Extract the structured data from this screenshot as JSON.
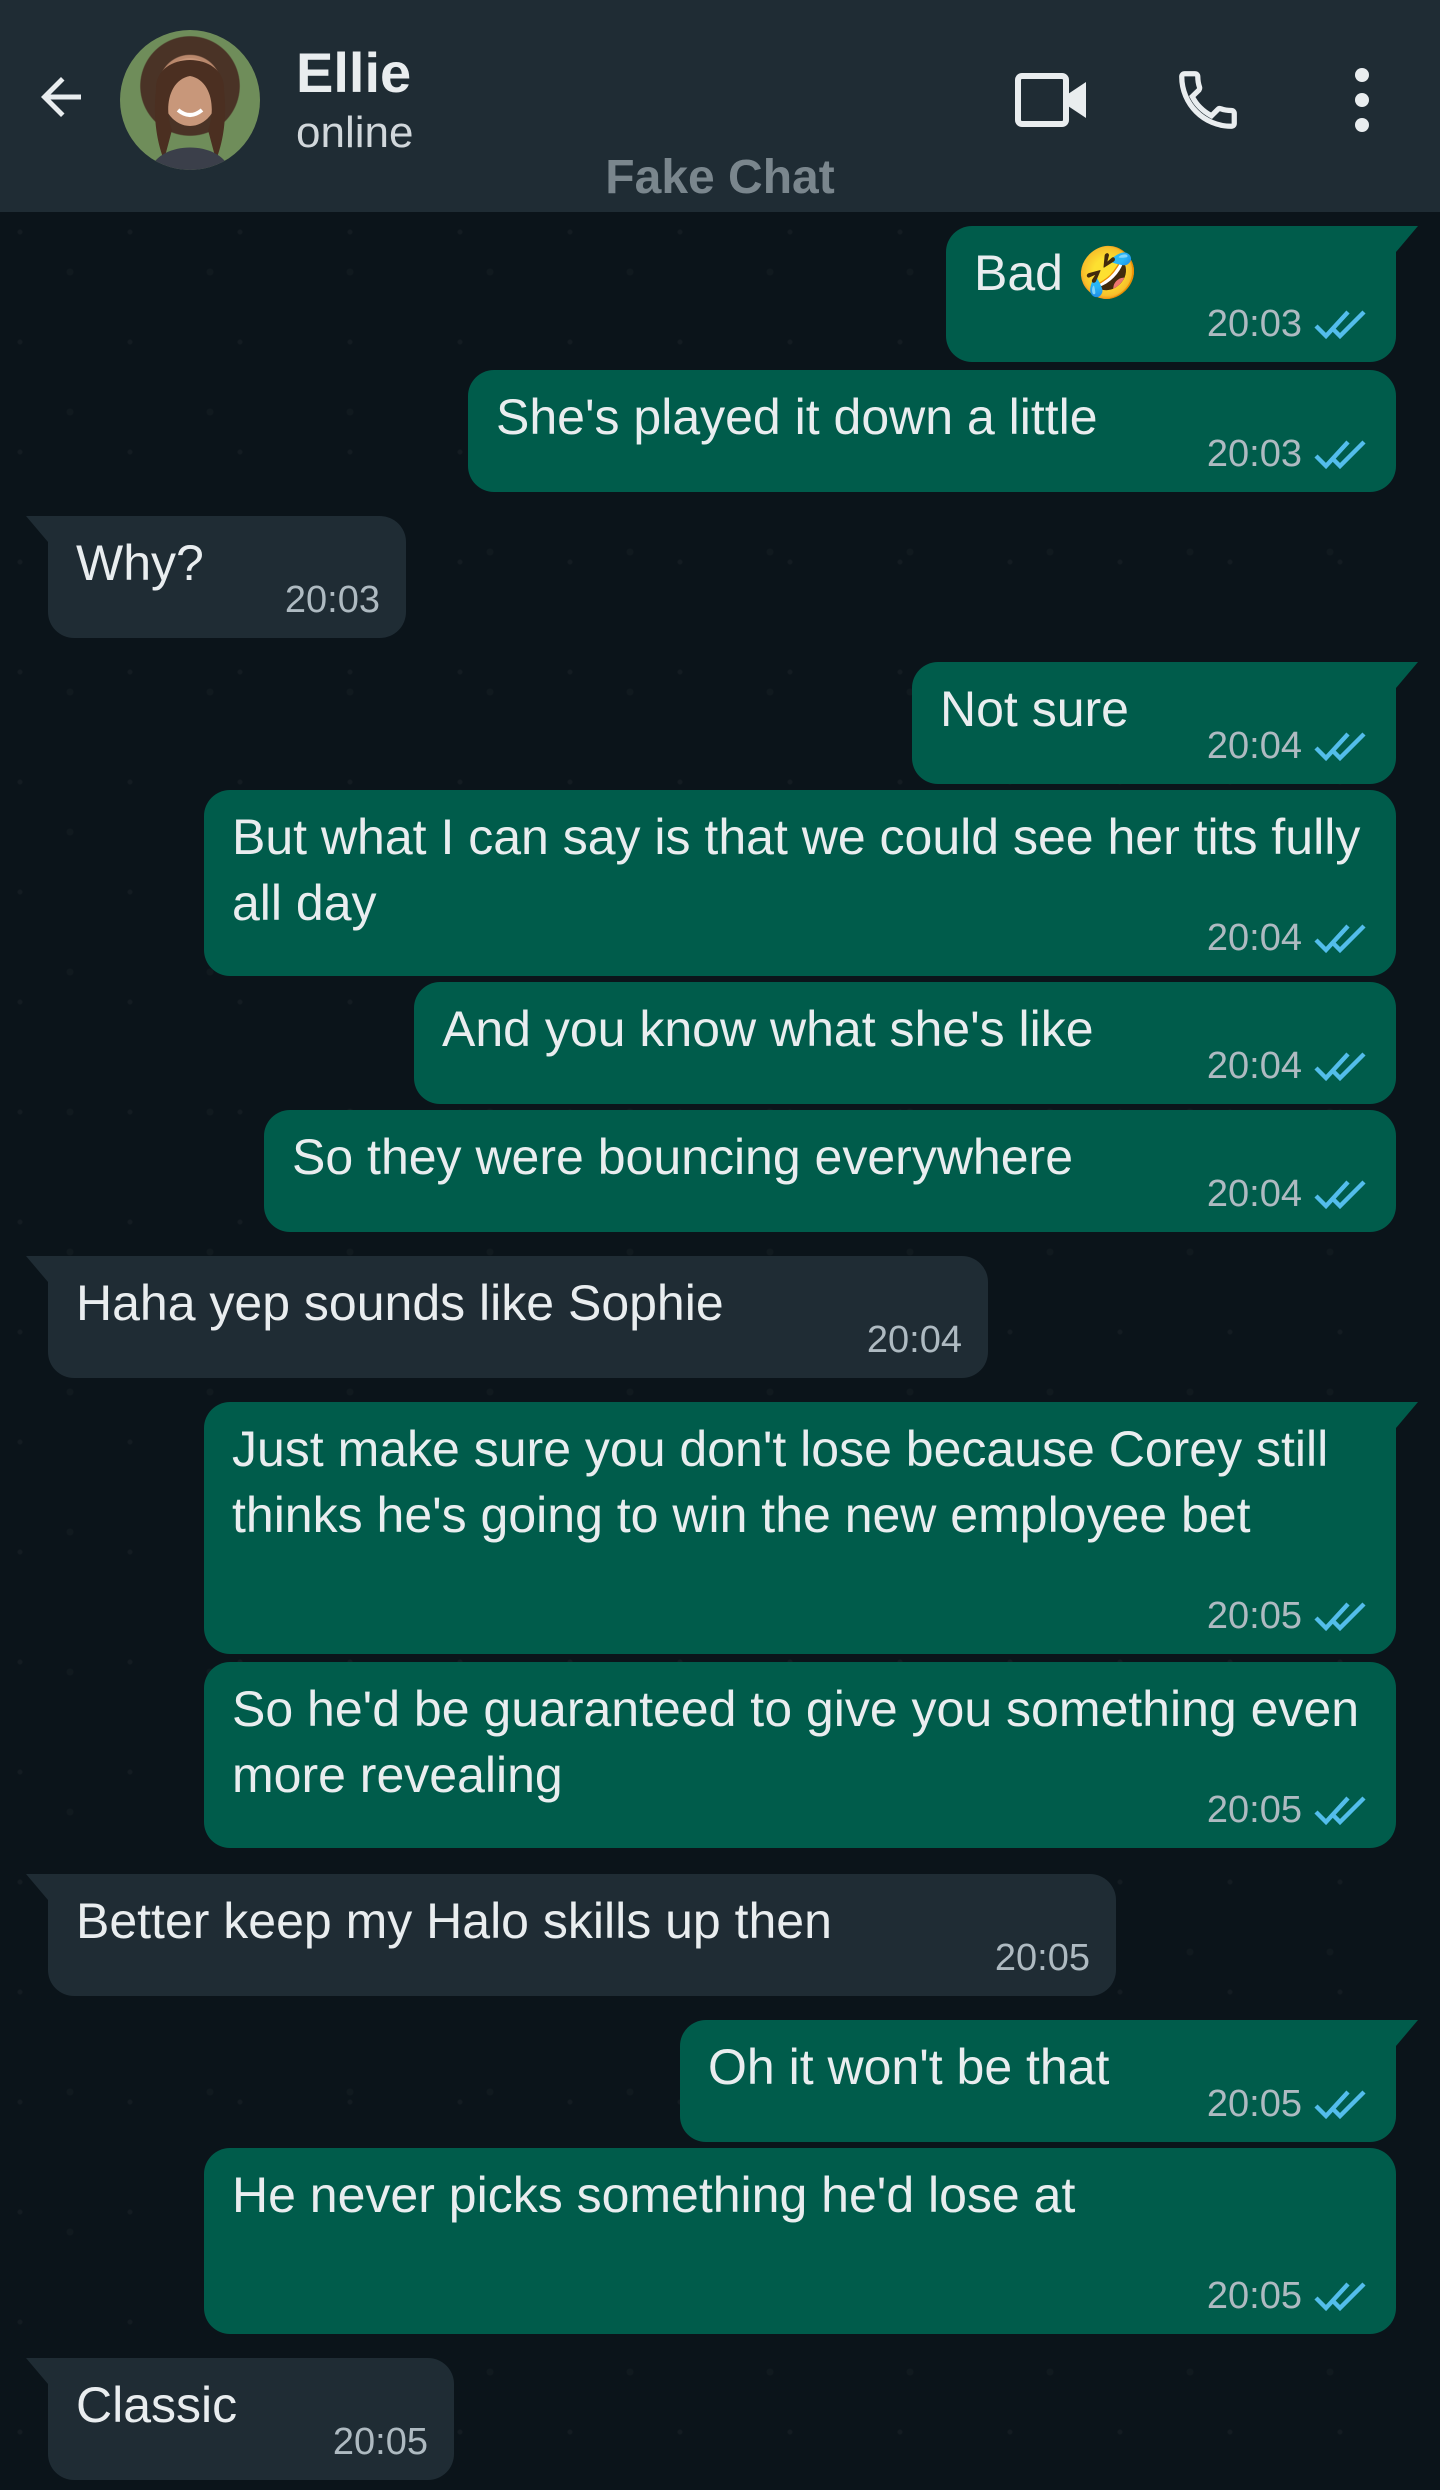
{
  "header": {
    "contact_name": "Ellie",
    "status": "online",
    "watermark": "Fake Chat"
  },
  "colors": {
    "header_bg": "#1f2c34",
    "outgoing_bubble": "#005c4b",
    "incoming_bubble": "#1f2c34",
    "read_ticks": "#53bdeb"
  },
  "messages": [
    {
      "dir": "out",
      "text": "Bad 🤣",
      "time": "20:03",
      "read": true
    },
    {
      "dir": "out",
      "text": "She's played it down a little",
      "time": "20:03",
      "read": true
    },
    {
      "dir": "in",
      "text": "Why?",
      "time": "20:03"
    },
    {
      "dir": "out",
      "text": "Not sure",
      "time": "20:04",
      "read": true
    },
    {
      "dir": "out",
      "text": "But what I can say is that we could see her tits fully all day",
      "time": "20:04",
      "read": true
    },
    {
      "dir": "out",
      "text": "And you know what she's like",
      "time": "20:04",
      "read": true
    },
    {
      "dir": "out",
      "text": "So they were bouncing everywhere",
      "time": "20:04",
      "read": true
    },
    {
      "dir": "in",
      "text": "Haha yep sounds like Sophie",
      "time": "20:04"
    },
    {
      "dir": "out",
      "text": "Just make sure you don't lose because Corey still thinks he's going to win the new employee bet",
      "time": "20:05",
      "read": true
    },
    {
      "dir": "out",
      "text": "So he'd be guaranteed to give you something even more revealing",
      "time": "20:05",
      "read": true
    },
    {
      "dir": "in",
      "text": "Better keep my Halo skills up then",
      "time": "20:05"
    },
    {
      "dir": "out",
      "text": "Oh it won't be that",
      "time": "20:05",
      "read": true
    },
    {
      "dir": "out",
      "text": "He never picks something he'd lose at",
      "time": "20:05",
      "read": true
    },
    {
      "dir": "in",
      "text": "Classic",
      "time": "20:05"
    }
  ]
}
